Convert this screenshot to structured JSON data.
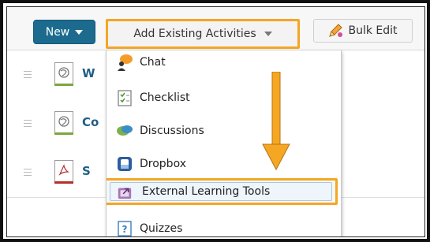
{
  "toolbar": {
    "new_label": "New",
    "add_existing_label": "Add Existing Activities",
    "bulk_edit_label": "Bulk Edit"
  },
  "rows": [
    {
      "title": "W",
      "icon": "web-page-icon",
      "strip": "#7aa73f"
    },
    {
      "title": "Co",
      "icon": "web-page-icon",
      "strip": "#7aa73f"
    },
    {
      "title": "S",
      "icon": "pdf-icon",
      "strip": "#b5302a"
    }
  ],
  "menu": {
    "items": [
      {
        "label": "Chat",
        "icon": "chat-icon"
      },
      {
        "label": "Checklist",
        "icon": "checklist-icon"
      },
      {
        "label": "Discussions",
        "icon": "discussions-icon"
      },
      {
        "label": "Dropbox",
        "icon": "dropbox-icon"
      },
      {
        "label": "External Learning Tools",
        "icon": "external-tool-icon",
        "highlighted": true
      },
      {
        "label": "Quizzes",
        "icon": "quiz-icon"
      }
    ]
  },
  "colors": {
    "highlight": "#f5a623",
    "primary_button": "#1c6b8e",
    "link": "#1f5f86"
  }
}
